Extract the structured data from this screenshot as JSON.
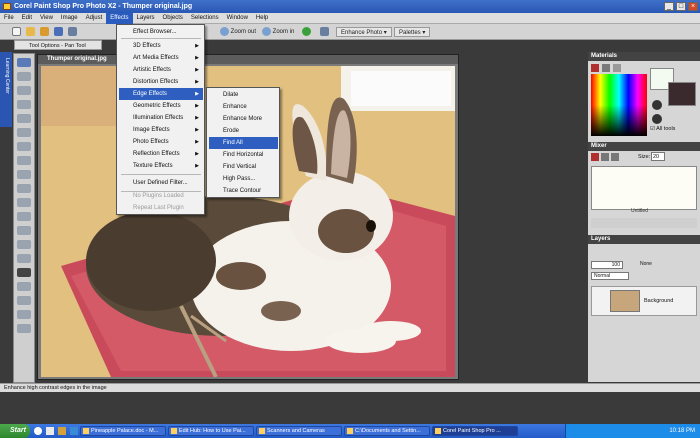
{
  "window": {
    "title": "Corel Paint Shop Pro Photo X2 - Thumper original.jpg"
  },
  "menubar": [
    "File",
    "Edit",
    "View",
    "Image",
    "Adjust",
    "Effects",
    "Layers",
    "Objects",
    "Selections",
    "Window",
    "Help"
  ],
  "toolbar": {
    "zoom_out": "Zoom out",
    "zoom_in": "Zoom in",
    "enhance_photo": "Enhance Photo",
    "palettes": "Palettes"
  },
  "tool_options": {
    "label": "Tool Options - Pan Tool"
  },
  "left_tab": {
    "label": "Learning Center"
  },
  "document": {
    "title": "Thumper original.jpg"
  },
  "effects_menu": {
    "items": [
      {
        "label": "Effect Browser...",
        "submenu": false,
        "disabled": false
      },
      {
        "label": "3D Effects",
        "submenu": true,
        "disabled": false
      },
      {
        "label": "Art Media Effects",
        "submenu": true,
        "disabled": false
      },
      {
        "label": "Artistic Effects",
        "submenu": true,
        "disabled": false
      },
      {
        "label": "Distortion Effects",
        "submenu": true,
        "disabled": false
      },
      {
        "label": "Edge Effects",
        "submenu": true,
        "disabled": false,
        "highlighted": true
      },
      {
        "label": "Geometric Effects",
        "submenu": true,
        "disabled": false
      },
      {
        "label": "Illumination Effects",
        "submenu": true,
        "disabled": false
      },
      {
        "label": "Image Effects",
        "submenu": true,
        "disabled": false
      },
      {
        "label": "Photo Effects",
        "submenu": true,
        "disabled": false
      },
      {
        "label": "Reflection Effects",
        "submenu": true,
        "disabled": false
      },
      {
        "label": "Texture Effects",
        "submenu": true,
        "disabled": false
      },
      {
        "label": "User Defined Filter...",
        "submenu": false,
        "disabled": false
      },
      {
        "label": "No Plugins Loaded",
        "submenu": false,
        "disabled": true
      },
      {
        "label": "Repeat Last Plugin",
        "submenu": false,
        "disabled": true
      }
    ]
  },
  "edge_submenu": {
    "items": [
      "Dilate",
      "Enhance",
      "Enhance More",
      "Erode",
      "Find All",
      "Find Horizontal",
      "Find Vertical",
      "High Pass...",
      "Trace Contour"
    ],
    "highlighted": "Find All"
  },
  "panels": {
    "materials": {
      "title": "Materials",
      "all_tools": "All tools"
    },
    "mixer": {
      "title": "Mixer",
      "size_label": "Size:",
      "size_value": "20",
      "untitled": "Untitled"
    },
    "layers": {
      "title": "Layers",
      "opacity": "100",
      "none": "None",
      "blend": "Normal",
      "layer_name": "Background"
    }
  },
  "status": {
    "text": "Enhance high contrast edges in the image"
  },
  "taskbar": {
    "start": "Start",
    "tasks": [
      "Pineapple Palace.doc - M...",
      "Edit Hub: How to Use Pai...",
      "Scanners and Cameras",
      "C:\\Documents and Settin...",
      "Corel Paint Shop Pro ..."
    ],
    "active_task": "Corel Paint Shop Pro ...",
    "clock": "10:18 PM"
  },
  "colors": {
    "menu_highlight": "#2e5fc0",
    "titlebar": "#2a58b5",
    "taskbar": "#225ac8"
  }
}
